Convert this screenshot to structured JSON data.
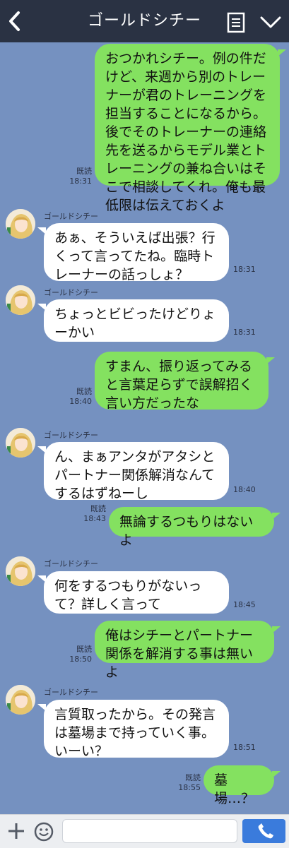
{
  "header": {
    "title": "ゴールドシチー",
    "icons": [
      "chevron-left-icon",
      "note-icon",
      "chevron-down-icon"
    ]
  },
  "colors": {
    "header_bg": "#2a3243",
    "chat_bg": "#7591c0",
    "outgoing_bubble": "#84e160",
    "incoming_bubble": "#ffffff",
    "send_button": "#3a7bdc"
  },
  "messages": [
    {
      "direction": "out",
      "text": "おつかれシチー。例の件だけど、来週から別のトレーナーが君のトレーニングを担当することになるから。後でそのトレーナーの連絡先を送るからモデル業とトレーニングの兼ね合いはそこで相談してくれ。俺も最低限は伝えておくよ",
      "read": "既読",
      "time": "18:31"
    },
    {
      "direction": "in",
      "sender": "ゴールドシチー",
      "text": "あぁ、そういえば出張？行くって言ってたね。臨時トレーナーの話っしょ？",
      "time": "18:31"
    },
    {
      "direction": "in",
      "sender": "ゴールドシチー",
      "text": "ちょっとビビったけどりょーかい",
      "time": "18:31"
    },
    {
      "direction": "out",
      "text": "すまん、振り返ってみると言葉足らずで誤解招く言い方だったな",
      "read": "既読",
      "time": "18:40"
    },
    {
      "direction": "in",
      "sender": "ゴールドシチー",
      "text": "ん、まぁアンタがアタシとパートナー関係解消なんてするはずねーし",
      "time": "18:40"
    },
    {
      "direction": "out",
      "text": "無論するつもりはないよ",
      "read": "既読",
      "time": "18:43"
    },
    {
      "direction": "in",
      "sender": "ゴールドシチー",
      "text": "何をするつもりがないって？詳しく言って",
      "time": "18:45"
    },
    {
      "direction": "out",
      "text": "俺はシチーとパートナー関係を解消する事は無いよ",
      "read": "既読",
      "time": "18:50"
    },
    {
      "direction": "in",
      "sender": "ゴールドシチー",
      "text": "言質取ったから。その発言は墓場まで持っていく事。いーい？",
      "time": "18:51"
    },
    {
      "direction": "out",
      "text": "墓場…？",
      "read": "既読",
      "time": "18:55"
    }
  ],
  "footer": {
    "input_value": "",
    "icons": [
      "plus-icon",
      "emoji-icon",
      "phone-icon"
    ]
  }
}
